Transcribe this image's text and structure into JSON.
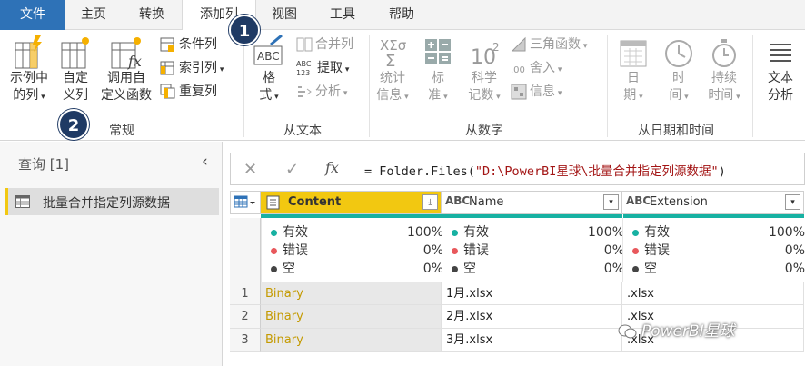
{
  "tabs": [
    {
      "label": "文件"
    },
    {
      "label": "主页"
    },
    {
      "label": "转换"
    },
    {
      "label": "添加列"
    },
    {
      "label": "视图"
    },
    {
      "label": "工具"
    },
    {
      "label": "帮助"
    }
  ],
  "ribbon": {
    "general": {
      "group_label": "常规",
      "col_from_examples": [
        "示例中",
        "的列"
      ],
      "custom_col": [
        "自定",
        "义列"
      ],
      "invoke_func": [
        "调用自",
        "定义函数"
      ],
      "conditional": "条件列",
      "index": "索引列",
      "duplicate": "重复列"
    },
    "from_text": {
      "group_label": "从文本",
      "format": [
        "格",
        "式"
      ],
      "merge": "合并列",
      "extract": "提取",
      "parse": "分析"
    },
    "from_number": {
      "group_label": "从数字",
      "statistics": [
        "统计",
        "信息"
      ],
      "standard": [
        "标",
        "准"
      ],
      "scientific": [
        "科学",
        "记数"
      ],
      "trig": "三角函数",
      "rounding": "舍入",
      "information": "信息"
    },
    "from_datetime": {
      "group_label": "从日期和时间",
      "date": [
        "日",
        "期"
      ],
      "time": [
        "时",
        "间"
      ],
      "duration": [
        "持续",
        "时间"
      ]
    },
    "text_analytics": [
      "文本",
      "分析"
    ]
  },
  "badges": {
    "one": "1",
    "two": "2"
  },
  "queries": {
    "title": "查询 [1]",
    "items": [
      {
        "name": "批量合并指定列源数据"
      }
    ]
  },
  "formula_bar": {
    "prefix": "= Folder.Files(",
    "string": "\"D:\\PowerBI星球\\批量合并指定列源数据\"",
    "suffix": ")"
  },
  "columns": [
    {
      "name": "Content",
      "type_icon": "table",
      "profile": {
        "valid": "100%",
        "error": "0%",
        "empty": "0%"
      }
    },
    {
      "name": "Name",
      "type_icon": "ABC",
      "profile": {
        "valid": "100%",
        "error": "0%",
        "empty": "0%"
      }
    },
    {
      "name": "Extension",
      "type_icon": "ABC",
      "profile": {
        "valid": "100%",
        "error": "0%",
        "empty": "0%"
      }
    }
  ],
  "profile_labels": {
    "valid": "有效",
    "error": "错误",
    "empty": "空"
  },
  "rows": [
    {
      "num": "1",
      "content": "Binary",
      "name": "1月.xlsx",
      "ext": ".xlsx"
    },
    {
      "num": "2",
      "content": "Binary",
      "name": "2月.xlsx",
      "ext": ".xlsx"
    },
    {
      "num": "3",
      "content": "Binary",
      "name": "3月.xlsx",
      "ext": ".xlsx"
    }
  ],
  "watermark": "PowerBI星球",
  "colors": {
    "accent": "#2e72b7",
    "selected_col": "#f2c811",
    "quality": "#17b1a2",
    "binary": "#c49a00"
  }
}
